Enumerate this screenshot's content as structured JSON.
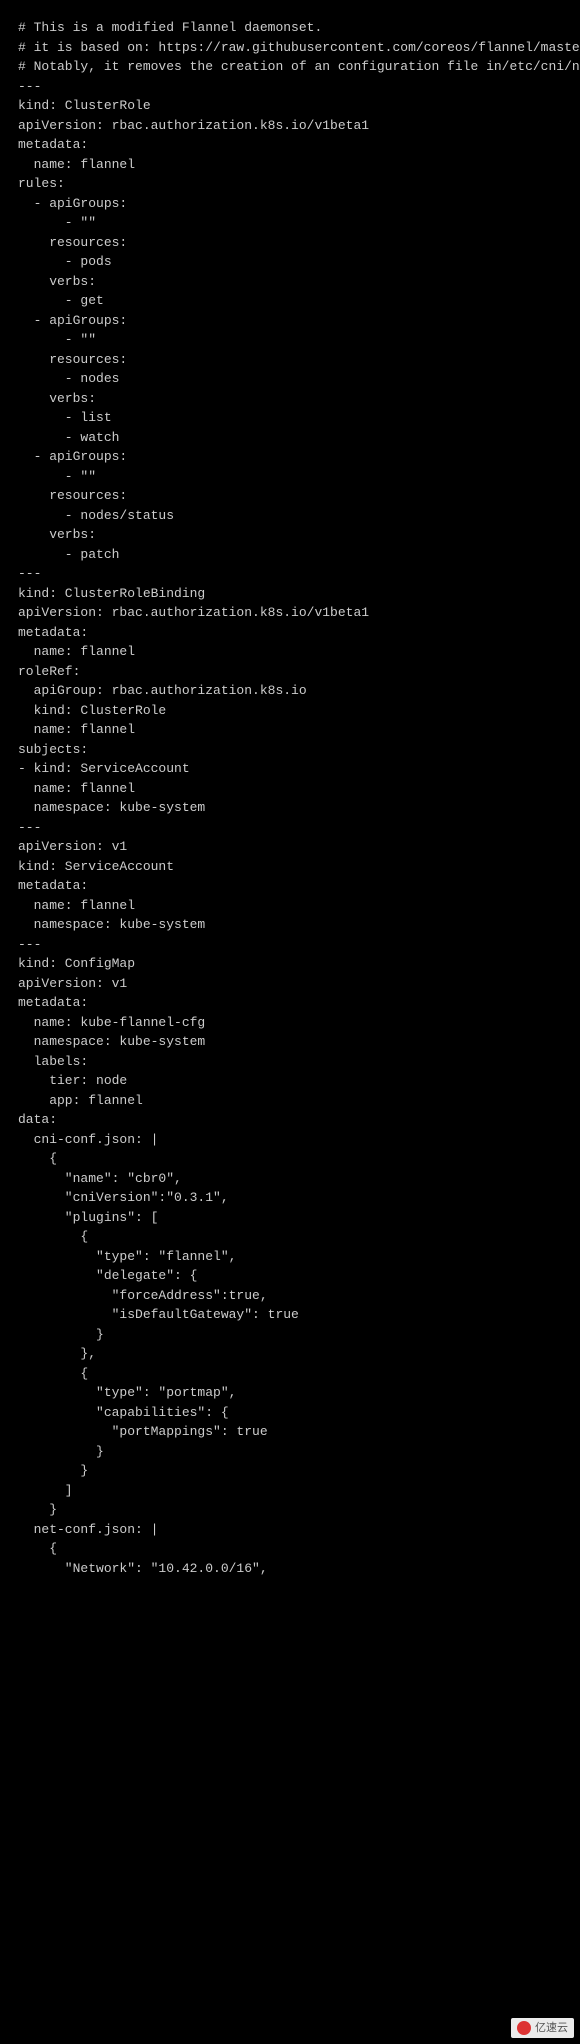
{
  "lines": [
    "# This is a modified Flannel daemonset.",
    "# it is based on: https://raw.githubusercontent.com/coreos/flannel/master/Documentation/kube-flannel.yml",
    "# Notably, it removes the creation of an configuration file in/etc/cni/net.d/",
    "---",
    "kind: ClusterRole",
    "apiVersion: rbac.authorization.k8s.io/v1beta1",
    "metadata:",
    "  name: flannel",
    "rules:",
    "  - apiGroups:",
    "      - \"\"",
    "    resources:",
    "      - pods",
    "    verbs:",
    "      - get",
    "  - apiGroups:",
    "      - \"\"",
    "    resources:",
    "      - nodes",
    "    verbs:",
    "      - list",
    "      - watch",
    "  - apiGroups:",
    "      - \"\"",
    "    resources:",
    "      - nodes/status",
    "    verbs:",
    "      - patch",
    "---",
    "kind: ClusterRoleBinding",
    "apiVersion: rbac.authorization.k8s.io/v1beta1",
    "metadata:",
    "  name: flannel",
    "roleRef:",
    "  apiGroup: rbac.authorization.k8s.io",
    "  kind: ClusterRole",
    "  name: flannel",
    "subjects:",
    "- kind: ServiceAccount",
    "  name: flannel",
    "  namespace: kube-system",
    "---",
    "apiVersion: v1",
    "kind: ServiceAccount",
    "metadata:",
    "  name: flannel",
    "  namespace: kube-system",
    "---",
    "kind: ConfigMap",
    "apiVersion: v1",
    "metadata:",
    "  name: kube-flannel-cfg",
    "  namespace: kube-system",
    "  labels:",
    "    tier: node",
    "    app: flannel",
    "data:",
    "  cni-conf.json: |",
    "    {",
    "      \"name\": \"cbr0\",",
    "      \"cniVersion\":\"0.3.1\",",
    "      \"plugins\": [",
    "        {",
    "          \"type\": \"flannel\",",
    "          \"delegate\": {",
    "            \"forceAddress\":true,",
    "            \"isDefaultGateway\": true",
    "          }",
    "        },",
    "        {",
    "          \"type\": \"portmap\",",
    "          \"capabilities\": {",
    "            \"portMappings\": true",
    "          }",
    "        }",
    "      ]",
    "    }",
    "  net-conf.json: |",
    "    {",
    "      \"Network\": \"10.42.0.0/16\","
  ],
  "watermark": "亿速云"
}
